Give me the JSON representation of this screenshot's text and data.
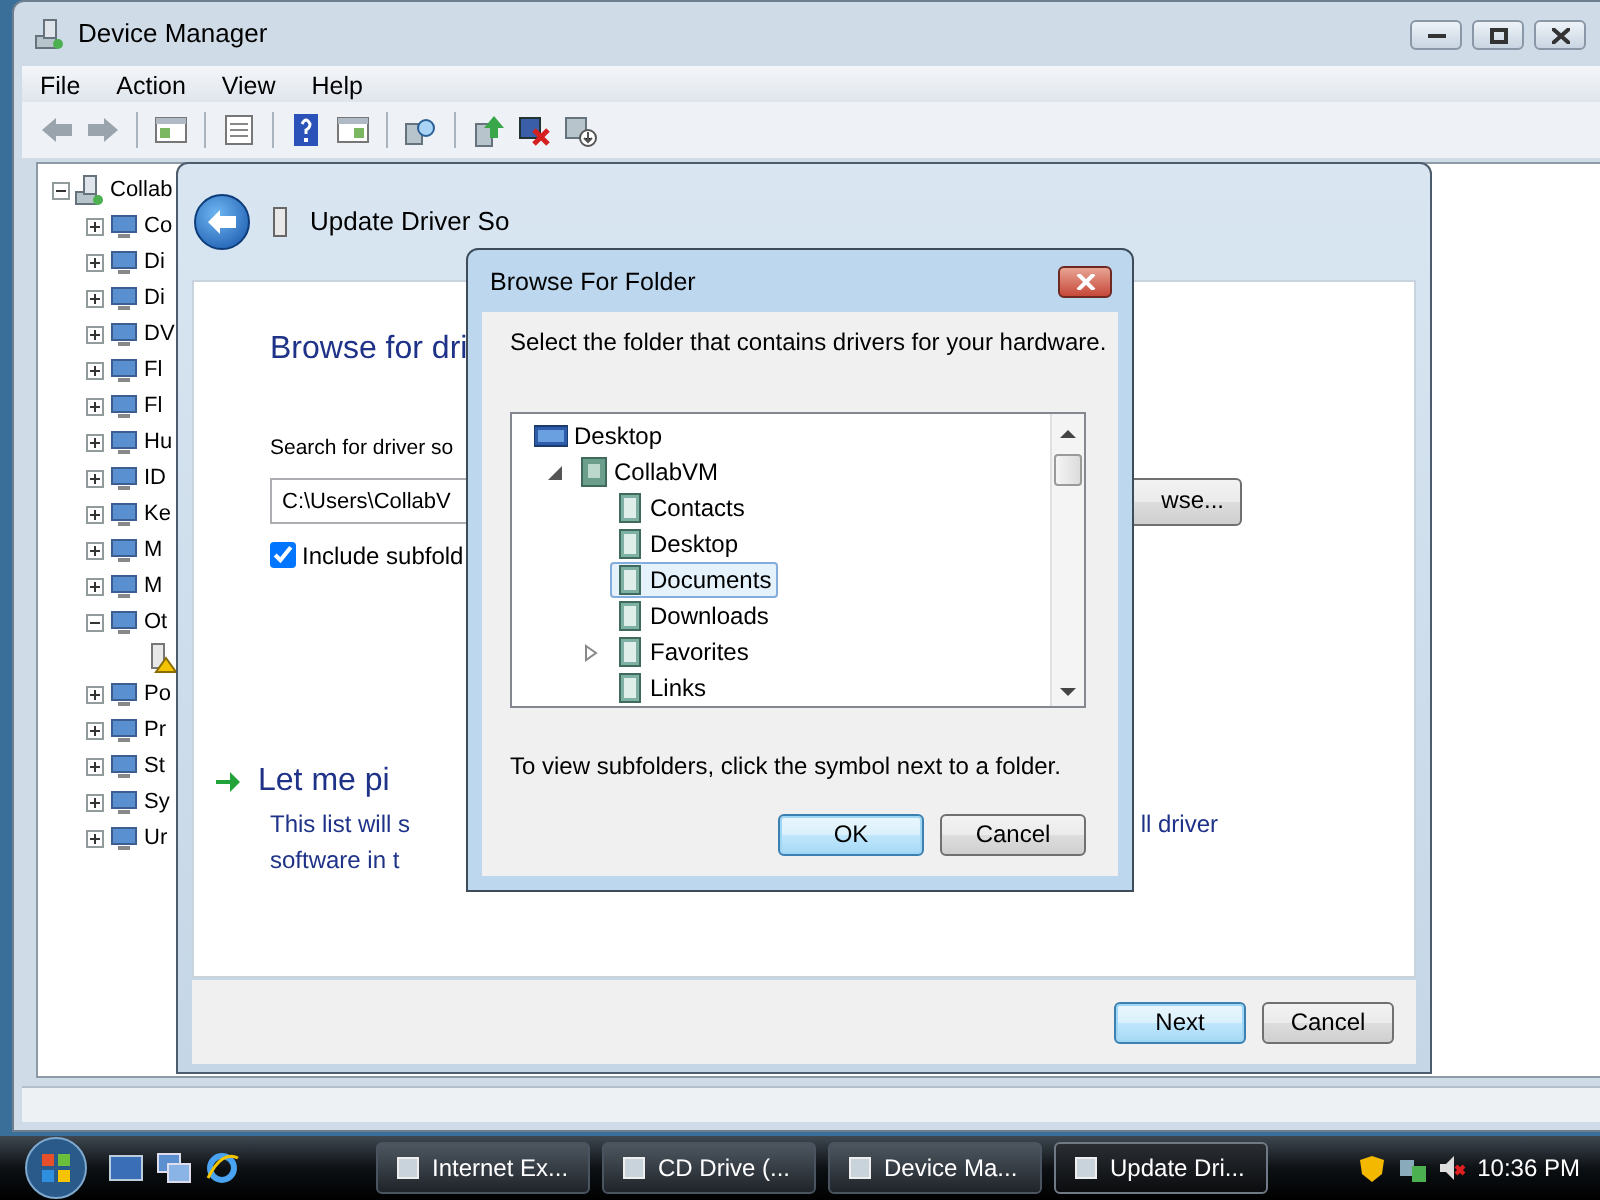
{
  "device_manager": {
    "title": "Device Manager",
    "menu": [
      "File",
      "Action",
      "View",
      "Help"
    ],
    "tree": [
      {
        "label": "Collab",
        "expanded": true,
        "children": [
          {
            "label": "Co",
            "expanded": false
          },
          {
            "label": "Di",
            "expanded": false
          },
          {
            "label": "Di",
            "expanded": false
          },
          {
            "label": "DV",
            "expanded": false
          },
          {
            "label": "Fl",
            "expanded": false
          },
          {
            "label": "Fl",
            "expanded": false
          },
          {
            "label": "Hu",
            "expanded": false
          },
          {
            "label": "ID",
            "expanded": false
          },
          {
            "label": "Ke",
            "expanded": false
          },
          {
            "label": "M",
            "expanded": false
          },
          {
            "label": "M",
            "expanded": false
          },
          {
            "label": "Ot",
            "expanded": true,
            "children": [
              {
                "kind": "warning"
              }
            ]
          },
          {
            "label": "Po",
            "expanded": false
          },
          {
            "label": "Pr",
            "expanded": false
          },
          {
            "label": "St",
            "expanded": false
          },
          {
            "label": "Sy",
            "expanded": false
          },
          {
            "label": "Ur",
            "expanded": false
          }
        ]
      }
    ]
  },
  "update_driver": {
    "title": "Update Driver So",
    "heading": "Browse for dri",
    "search_label": "Search for driver so",
    "path": "C:\\Users\\CollabV",
    "browse_button": "wse...",
    "include_subfolders": {
      "label": "Include subfold",
      "checked": true
    },
    "pick_option": {
      "title": "Let me pi",
      "description_lines": [
        "This list will s",
        "software in t"
      ],
      "description_right": "ll driver"
    },
    "buttons": [
      {
        "label": "Next",
        "default": true
      },
      {
        "label": "Cancel",
        "default": false
      }
    ]
  },
  "browse_dialog": {
    "title": "Browse For Folder",
    "instruction": "Select the folder that contains drivers for your hardware.",
    "tree": [
      {
        "label": "Desktop",
        "kind": "desktop",
        "selected": false,
        "children": [
          {
            "label": "CollabVM",
            "kind": "user",
            "selected": false,
            "expanded": true,
            "children": [
              {
                "label": "Contacts",
                "kind": "folder",
                "selected": false
              },
              {
                "label": "Desktop",
                "kind": "folder",
                "selected": false
              },
              {
                "label": "Documents",
                "kind": "folder",
                "selected": true
              },
              {
                "label": "Downloads",
                "kind": "folder",
                "selected": false
              },
              {
                "label": "Favorites",
                "kind": "folder",
                "selected": false,
                "expanded": false
              },
              {
                "label": "Links",
                "kind": "folder",
                "selected": false
              }
            ]
          }
        ]
      }
    ],
    "hint": "To view subfolders, click the symbol next to a folder.",
    "buttons": [
      {
        "label": "OK",
        "default": true
      },
      {
        "label": "Cancel",
        "default": false
      }
    ]
  },
  "taskbar": {
    "tasks": [
      {
        "label": "Internet Ex...",
        "selected": false
      },
      {
        "label": "CD Drive (...",
        "selected": false
      },
      {
        "label": "Device Ma...",
        "selected": false
      },
      {
        "label": "Update Dri...",
        "selected": true
      }
    ],
    "clock": "10:36 PM"
  }
}
